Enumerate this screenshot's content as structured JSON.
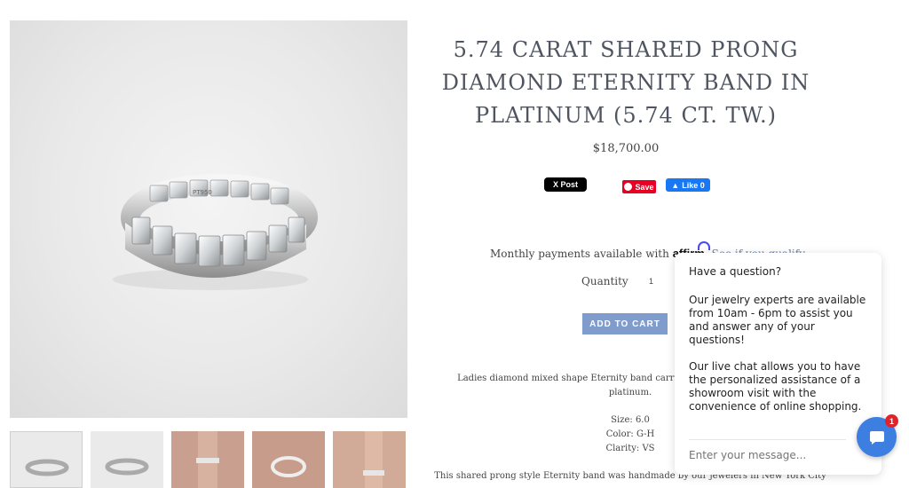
{
  "product": {
    "title": "5.74 CARAT SHARED PRONG DIAMOND ETERNITY BAND IN PLATINUM (5.74 CT. TW.)",
    "price": "$18,700.00",
    "main_image_alt": "Diamond eternity band ring"
  },
  "social": {
    "x_post": "X Post",
    "pin_save": "Save",
    "fb_like": "Like 0"
  },
  "affirm": {
    "text": "Monthly payments available with",
    "logo": "affirm",
    "link": "See if you qualify"
  },
  "quantity": {
    "label": "Quantity",
    "value": "1"
  },
  "cart": {
    "button": "ADD TO CART"
  },
  "description": {
    "intro": "Ladies diamond mixed shape Eternity band carries 5.74ct of diamonds set in",
    "intro2": "platinum.",
    "size": "Size: 6.0",
    "color": "Color: G-H",
    "clarity": "Clarity: VS",
    "handmade": "This shared prong style Eternity band was handmade by our jewelers in New York City"
  },
  "chat": {
    "question": "Have a question?",
    "p1": "Our jewelry experts are available from 10am - 6pm to assist you and answer any of your questions!",
    "p2": "Our live chat allows you to have the personalized assistance of a showroom visit with the convenience of online shopping.",
    "input_placeholder": "Enter your message...",
    "badge_count": "1"
  },
  "colors": {
    "accent": "#7f9ccc",
    "title": "#4f5560",
    "chat_button": "#3c7fe0",
    "badge": "#e0232b"
  }
}
